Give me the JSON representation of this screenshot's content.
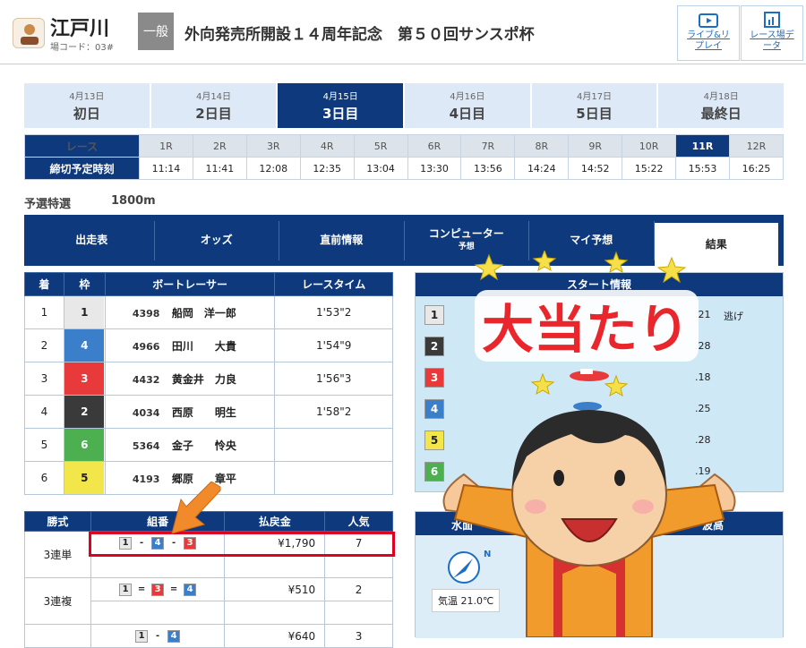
{
  "header": {
    "venue": "江戸川",
    "venue_code": "場コード：03#",
    "grade": "一般",
    "title": "外向発売所開設１４周年記念　第５０回サンスポ杯",
    "live_label": "ライブ&リプレイ",
    "data_label": "レース場データ"
  },
  "days": [
    {
      "date": "4月13日",
      "label": "初日"
    },
    {
      "date": "4月14日",
      "label": "2日目"
    },
    {
      "date": "4月15日",
      "label": "3日目"
    },
    {
      "date": "4月16日",
      "label": "4日目"
    },
    {
      "date": "4月17日",
      "label": "5日目"
    },
    {
      "date": "4月18日",
      "label": "最終日"
    }
  ],
  "races": {
    "race_label": "レース",
    "time_label": "締切予定時刻",
    "numbers": [
      "1R",
      "2R",
      "3R",
      "4R",
      "5R",
      "6R",
      "7R",
      "8R",
      "9R",
      "10R",
      "11R",
      "12R"
    ],
    "times": [
      "11:14",
      "11:41",
      "12:08",
      "12:35",
      "13:04",
      "13:30",
      "13:56",
      "14:24",
      "14:52",
      "15:22",
      "15:53",
      "16:25"
    ]
  },
  "race_info": {
    "type": "予選特選",
    "distance": "1800m"
  },
  "nav": {
    "items": [
      "出走表",
      "オッズ",
      "直前情報",
      "コンピューター",
      "マイ予想",
      "結果"
    ],
    "sub": "予想"
  },
  "result": {
    "headers": [
      "着",
      "枠",
      "ボートレーサー",
      "レースタイム"
    ],
    "rows": [
      {
        "rank": "1",
        "frame": "1",
        "no": "4398",
        "name": "船岡　洋一郎",
        "time": "1'53\"2"
      },
      {
        "rank": "2",
        "frame": "4",
        "no": "4966",
        "name": "田川　　大貴",
        "time": "1'54\"9"
      },
      {
        "rank": "3",
        "frame": "3",
        "no": "4432",
        "name": "黄金井　力良",
        "time": "1'56\"3"
      },
      {
        "rank": "4",
        "frame": "2",
        "no": "4034",
        "name": "西原　　明生",
        "time": "1'58\"2"
      },
      {
        "rank": "5",
        "frame": "6",
        "no": "5364",
        "name": "金子　　怜央",
        "time": ""
      },
      {
        "rank": "6",
        "frame": "5",
        "no": "4193",
        "name": "郷原　　章平",
        "time": ""
      }
    ]
  },
  "start": {
    "title": "スタート情報",
    "rows": [
      {
        "b": "1",
        "v": ".21",
        "n": "逃げ"
      },
      {
        "b": "2",
        "v": ".28",
        "n": ""
      },
      {
        "b": "3",
        "v": ".18",
        "n": ""
      },
      {
        "b": "4",
        "v": ".25",
        "n": ""
      },
      {
        "b": "5",
        "v": ".28",
        "n": ""
      },
      {
        "b": "6",
        "v": ".19",
        "n": ""
      }
    ]
  },
  "payout": {
    "headers": [
      "勝式",
      "組番",
      "払戻金",
      "人気"
    ],
    "rows": [
      {
        "type": "3連単",
        "combo": [
          "1",
          "-",
          "4",
          "-",
          "3"
        ],
        "amount": "¥1,790",
        "pop": "7"
      },
      {
        "type": "3連複",
        "combo": [
          "1",
          "=",
          "3",
          "=",
          "4"
        ],
        "amount": "¥510",
        "pop": "2"
      },
      {
        "type": "",
        "combo": [
          "1",
          "-",
          "4"
        ],
        "amount": "¥640",
        "pop": "3"
      }
    ]
  },
  "weather": {
    "title_left": "水面",
    "title_right": "波高",
    "temp": "気温 21.0℃",
    "dir": "N"
  },
  "overlay": {
    "banner": "大当たり"
  },
  "colors": {
    "b1": "#e8e8e8",
    "b2": "#3a3a3a",
    "b3": "#e83a3a",
    "b4": "#3b7ec9",
    "b5": "#f2e64a",
    "b6": "#4caf50",
    "navy": "#0e3a7d"
  }
}
